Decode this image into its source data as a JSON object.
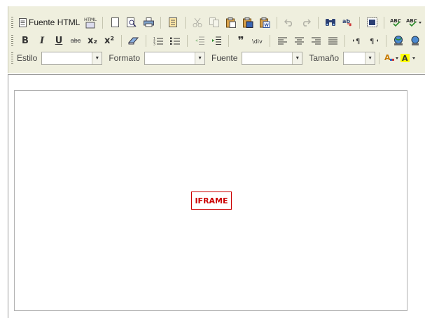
{
  "toolbar_row1": {
    "source_label": "Fuente HTML",
    "html_badge": "HTML",
    "icons": [
      "source-icon",
      "html-preview-icon",
      "new-page-icon",
      "preview-icon",
      "print-icon",
      "templates-icon",
      "cut-icon",
      "copy-icon",
      "paste-icon",
      "paste-text-icon",
      "paste-word-icon",
      "undo-icon",
      "redo-icon",
      "find-icon",
      "replace-icon",
      "select-all-icon",
      "spellcheck-icon",
      "spellcheck-dropdown-icon"
    ]
  },
  "toolbar_row2": {
    "bold": "B",
    "italic": "I",
    "underline": "U",
    "strike": "abc",
    "subscript": "x₂",
    "superscript": "x²",
    "blockquote": "❞",
    "abc": "ABC"
  },
  "toolbar_row3": {
    "style_label": "Estilo",
    "style_value": "",
    "format_label": "Formato",
    "format_value": "",
    "font_label": "Fuente",
    "font_value": "",
    "size_label": "Tamaño",
    "size_value": "",
    "text_color_glyph": "A",
    "bg_color_glyph": "A"
  },
  "editor": {
    "iframe_label": "IFRAME"
  },
  "colors": {
    "toolbar_bg": "#efefde",
    "iframe_red": "#cc0000",
    "text_color_bar": "#cc3333",
    "bg_color_bar": "#ffff00"
  }
}
